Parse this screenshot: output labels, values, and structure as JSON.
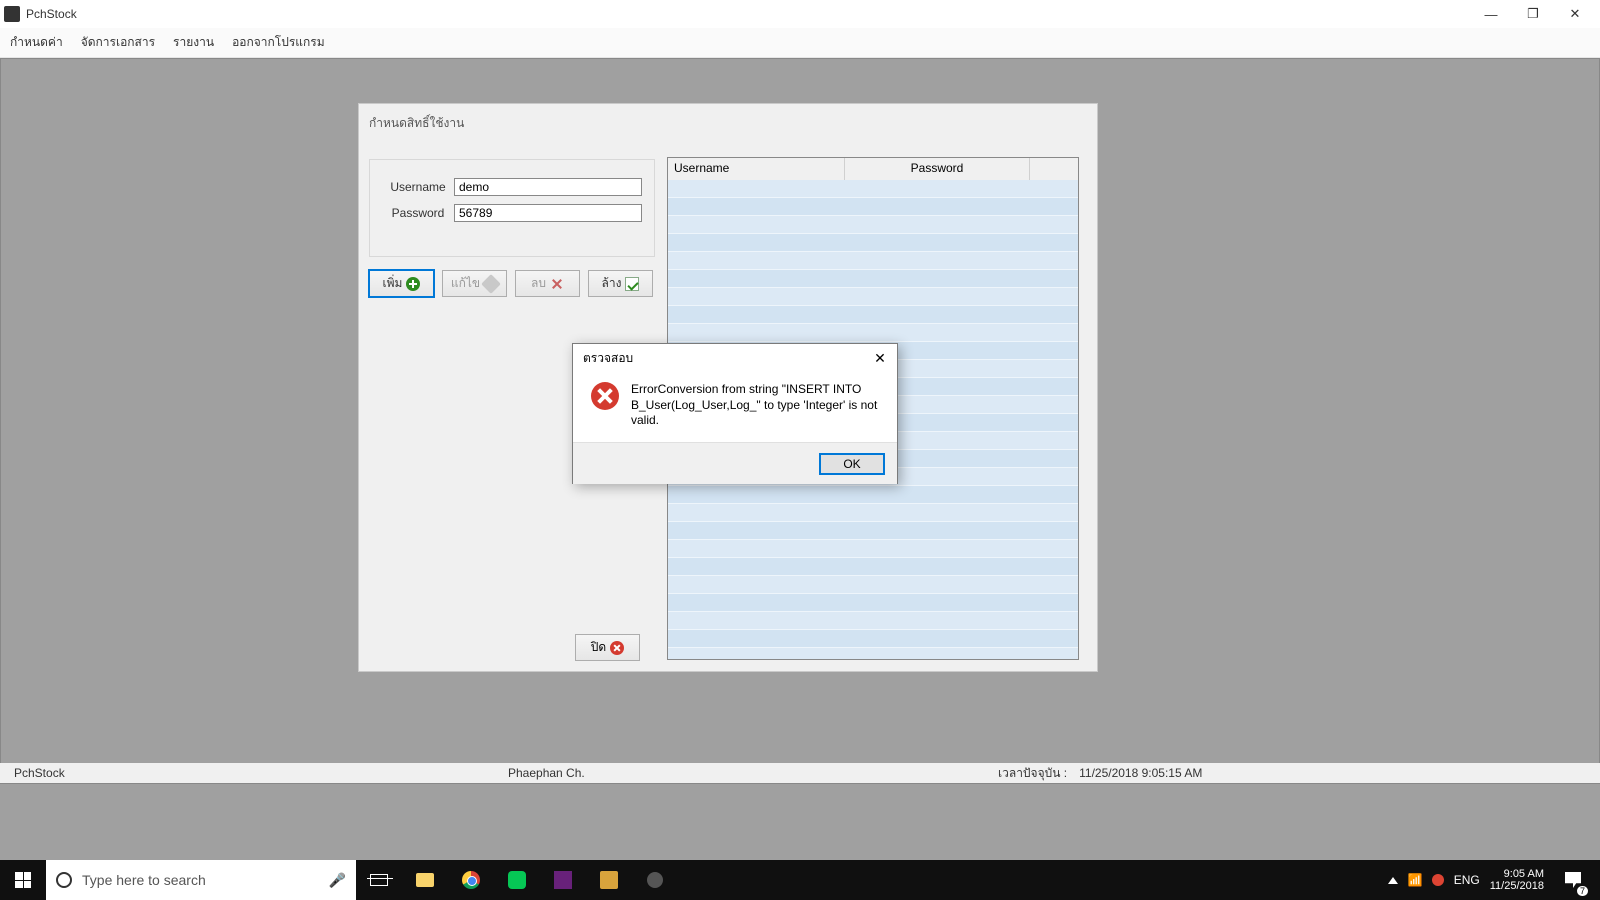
{
  "window": {
    "title": "PchStock",
    "title_btns": {
      "min": "—",
      "max": "❐",
      "close": "✕"
    }
  },
  "menu": [
    "กำหนดค่า",
    "จัดการเอกสาร",
    "รายงาน",
    "ออกจากโปรแกรม"
  ],
  "panel": {
    "title": "กำหนดสิทธิ์ใช้งาน",
    "fields": {
      "username_label": "Username",
      "username_value": "demo",
      "password_label": "Password",
      "password_value": "56789"
    },
    "buttons": {
      "add": "เพิ่ม",
      "edit": "แก้ไข",
      "delete": "ลบ",
      "clear": "ล้าง",
      "close": "ปิด"
    },
    "grid_headers": {
      "c1": "Username",
      "c2": "Password"
    }
  },
  "msg": {
    "title": "ตรวจสอบ",
    "text": "ErrorConversion from string \"INSERT INTO B_User(Log_User,Log_\" to type 'Integer' is not valid.",
    "ok": "OK"
  },
  "status": {
    "app": "PchStock",
    "user": "Phaephan  Ch.",
    "time_label": "เวลาปัจจุบัน :",
    "time_value": "11/25/2018 9:05:15 AM"
  },
  "taskbar": {
    "search_placeholder": "Type here to search",
    "lang": "ENG",
    "time": "9:05 AM",
    "date": "11/25/2018",
    "notif_count": "7"
  }
}
